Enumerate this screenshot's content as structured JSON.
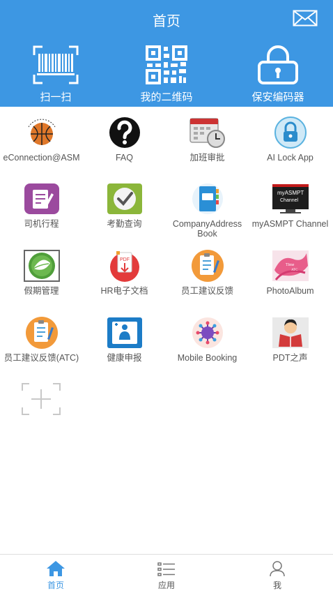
{
  "header": {
    "title": "首页",
    "bg_color": "#3d97e3",
    "mail_icon": "mail-icon"
  },
  "quick_actions": [
    {
      "label": "扫一扫",
      "icon": "barcode-scan-icon"
    },
    {
      "label": "我的二维码",
      "icon": "qr-code-icon"
    },
    {
      "label": "保安编码器",
      "icon": "padlock-icon"
    }
  ],
  "apps": [
    {
      "label": "eConnection@ASM",
      "icon": "basketball-logo-icon"
    },
    {
      "label": "FAQ",
      "icon": "question-mark-icon"
    },
    {
      "label": "加班审批",
      "icon": "calendar-clock-icon"
    },
    {
      "label": "AI Lock App",
      "icon": "lock-circle-icon"
    },
    {
      "label": "司机行程",
      "icon": "notepad-pen-icon"
    },
    {
      "label": "考勤查询",
      "icon": "checkmark-icon"
    },
    {
      "label": "CompanyAddress Book",
      "icon": "address-book-icon"
    },
    {
      "label": "myASMPT Channel",
      "icon": "monitor-channel-icon"
    },
    {
      "label": "假期管理",
      "icon": "leaf-icon"
    },
    {
      "label": "HR电子文档",
      "icon": "pdf-document-icon"
    },
    {
      "label": "员工建议反馈",
      "icon": "clipboard-feedback-icon"
    },
    {
      "label": "PhotoAlbum",
      "icon": "photo-album-icon"
    },
    {
      "label": "员工建议反馈(ATC)",
      "icon": "clipboard-feedback-icon"
    },
    {
      "label": "健康申报",
      "icon": "health-declaration-icon"
    },
    {
      "label": "Mobile Booking",
      "icon": "virus-booking-icon"
    },
    {
      "label": "PDT之声",
      "icon": "reading-person-icon"
    }
  ],
  "add_app": {
    "icon": "add-app-icon"
  },
  "tabbar": {
    "active_color": "#3d97e3",
    "tabs": [
      {
        "label": "首页",
        "icon": "home-icon",
        "active": true
      },
      {
        "label": "应用",
        "icon": "app-list-icon",
        "active": false
      },
      {
        "label": "我",
        "icon": "person-icon",
        "active": false
      }
    ]
  }
}
